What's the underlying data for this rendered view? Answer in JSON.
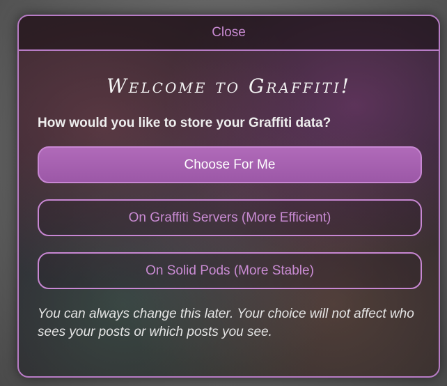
{
  "dialog": {
    "close_label": "Close",
    "title": "Welcome to Graffiti!",
    "question": "How would you like to store your Graffiti data?",
    "options": [
      {
        "label": "Choose For Me",
        "selected": true
      },
      {
        "label": "On Graffiti Servers (More Efficient)",
        "selected": false
      },
      {
        "label": "On Solid Pods (More Stable)",
        "selected": false
      }
    ],
    "note": "You can always change this later. Your choice will not affect who sees your posts or which posts you see."
  },
  "colors": {
    "accent": "#c887d3",
    "primary_fill": "#a862b2",
    "text": "#eeeeee"
  }
}
